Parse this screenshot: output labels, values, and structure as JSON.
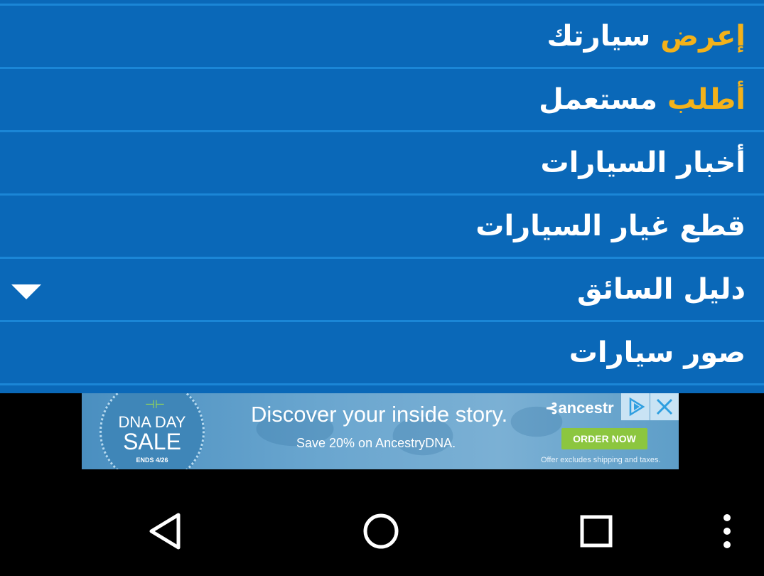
{
  "menu": {
    "items": [
      {
        "accent": "إعرض",
        "rest": " سيارتك"
      },
      {
        "accent": "أطلب",
        "rest": " مستعمل"
      },
      {
        "accent": "",
        "rest": "أخبار السيارات"
      },
      {
        "accent": "",
        "rest": "قطع غيار السيارات"
      },
      {
        "accent": "",
        "rest": "دليل السائق"
      },
      {
        "accent": "",
        "rest": "صور سيارات"
      }
    ],
    "expand_icon": "caret-down-icon"
  },
  "ad": {
    "badge_line1": "DNA DAY",
    "badge_line2": "SALE",
    "badge_line3": "ENDS 4/26",
    "headline": "Discover your inside story.",
    "subline": "Save 20% on AncestryDNA.",
    "brand": "ancestr",
    "order_button": "ORDER NOW",
    "disclaimer": "Offer excludes shipping and taxes."
  },
  "navbar": {
    "back_icon": "back-triangle-icon",
    "home_icon": "home-circle-icon",
    "recents_icon": "recents-square-icon",
    "menu_icon": "overflow-dots-icon"
  },
  "colors": {
    "menu_bg": "#0a68b8",
    "separator": "#1b86d6",
    "accent": "#f3b21a"
  }
}
